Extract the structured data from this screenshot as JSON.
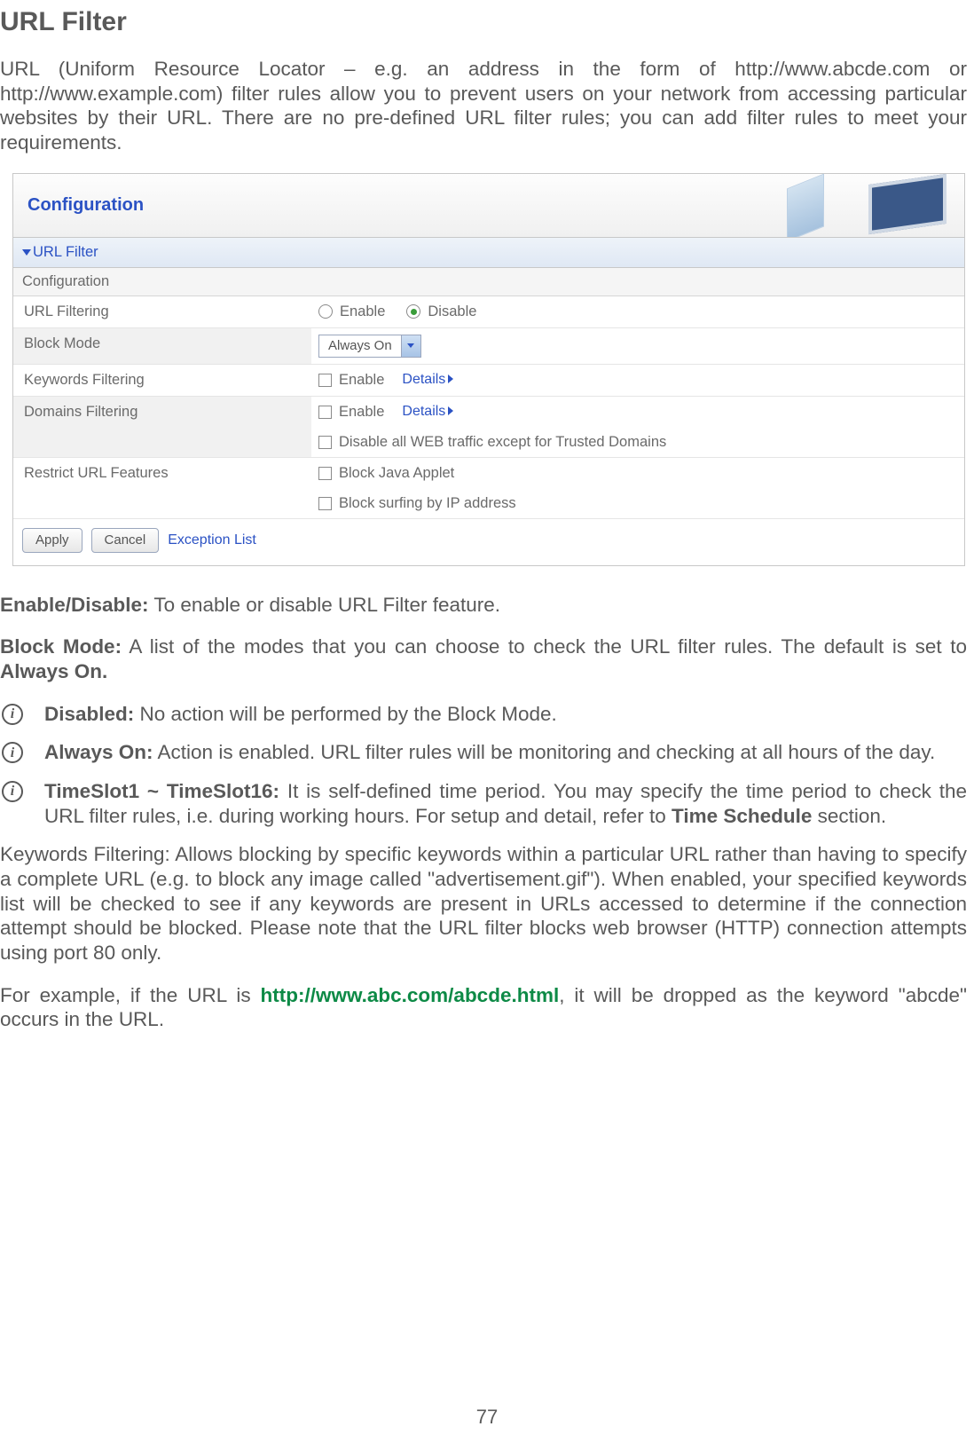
{
  "headline": "URL Filter",
  "intro": "URL (Uniform Resource Locator – e.g. an address in the form of http://www.abcde.com or http://www.example.com) filter rules allow you to prevent users on your network from accessing particular websites by their URL. There are no pre-defined URL filter rules; you can add filter rules to meet your requirements.",
  "panel": {
    "configuration": "Configuration",
    "section": "URL Filter",
    "subhead": "Configuration",
    "rows": {
      "url_filtering": {
        "label": "URL Filtering",
        "enable": "Enable",
        "disable": "Disable"
      },
      "block_mode": {
        "label": "Block Mode",
        "selected": "Always On"
      },
      "keywords": {
        "label": "Keywords Filtering",
        "enable": "Enable",
        "details": "Details"
      },
      "domains": {
        "label": "Domains Filtering",
        "enable": "Enable",
        "details": "Details",
        "disable_web": "Disable all WEB traffic except for Trusted Domains"
      },
      "restrict": {
        "label": "Restrict URL Features",
        "java": "Block Java Applet",
        "ip": "Block surfing by IP address"
      }
    },
    "buttons": {
      "apply": "Apply",
      "cancel": "Cancel",
      "exception": "Exception List"
    }
  },
  "desc": {
    "enable_label": "Enable/Disable:",
    "enable_text": " To enable or disable URL Filter feature.",
    "block_label": "Block Mode:",
    "block_text_a": " A list of the modes that you can choose to check the URL filter rules. The default is set to ",
    "block_text_b": "Always On.",
    "bullets": {
      "disabled_l": "Disabled:",
      "disabled_t": " No action will be performed by the Block Mode.",
      "always_l": "Always On:",
      "always_t": " Action is enabled.  URL filter rules will be monitoring and checking at all hours of the day.",
      "time_l": "TimeSlot1 ~ TimeSlot16:",
      "time_t_a": "   It is self-defined time period.  You may specify the time period to check the URL filter rules, i.e. during working hours. For setup and detail, refer to ",
      "time_t_b": "Time Schedule",
      "time_t_c": " section."
    },
    "kw_para": "Keywords Filtering: Allows blocking by specific keywords within a particular URL rather than having to specify a complete URL (e.g. to block any image called \"advertisement.gif\"). When enabled, your specified keywords list will be checked to see if any keywords are present in URLs accessed to determine if the connection attempt should be blocked. Please note that the URL filter blocks web browser (HTTP) connection attempts using port 80 only.",
    "ex_a": "For example, if the URL is ",
    "ex_url": "http://www.abc.com/abcde.html",
    "ex_b": ", it will be dropped as the keyword \"abcde\" occurs in the URL."
  },
  "page_number": "77"
}
